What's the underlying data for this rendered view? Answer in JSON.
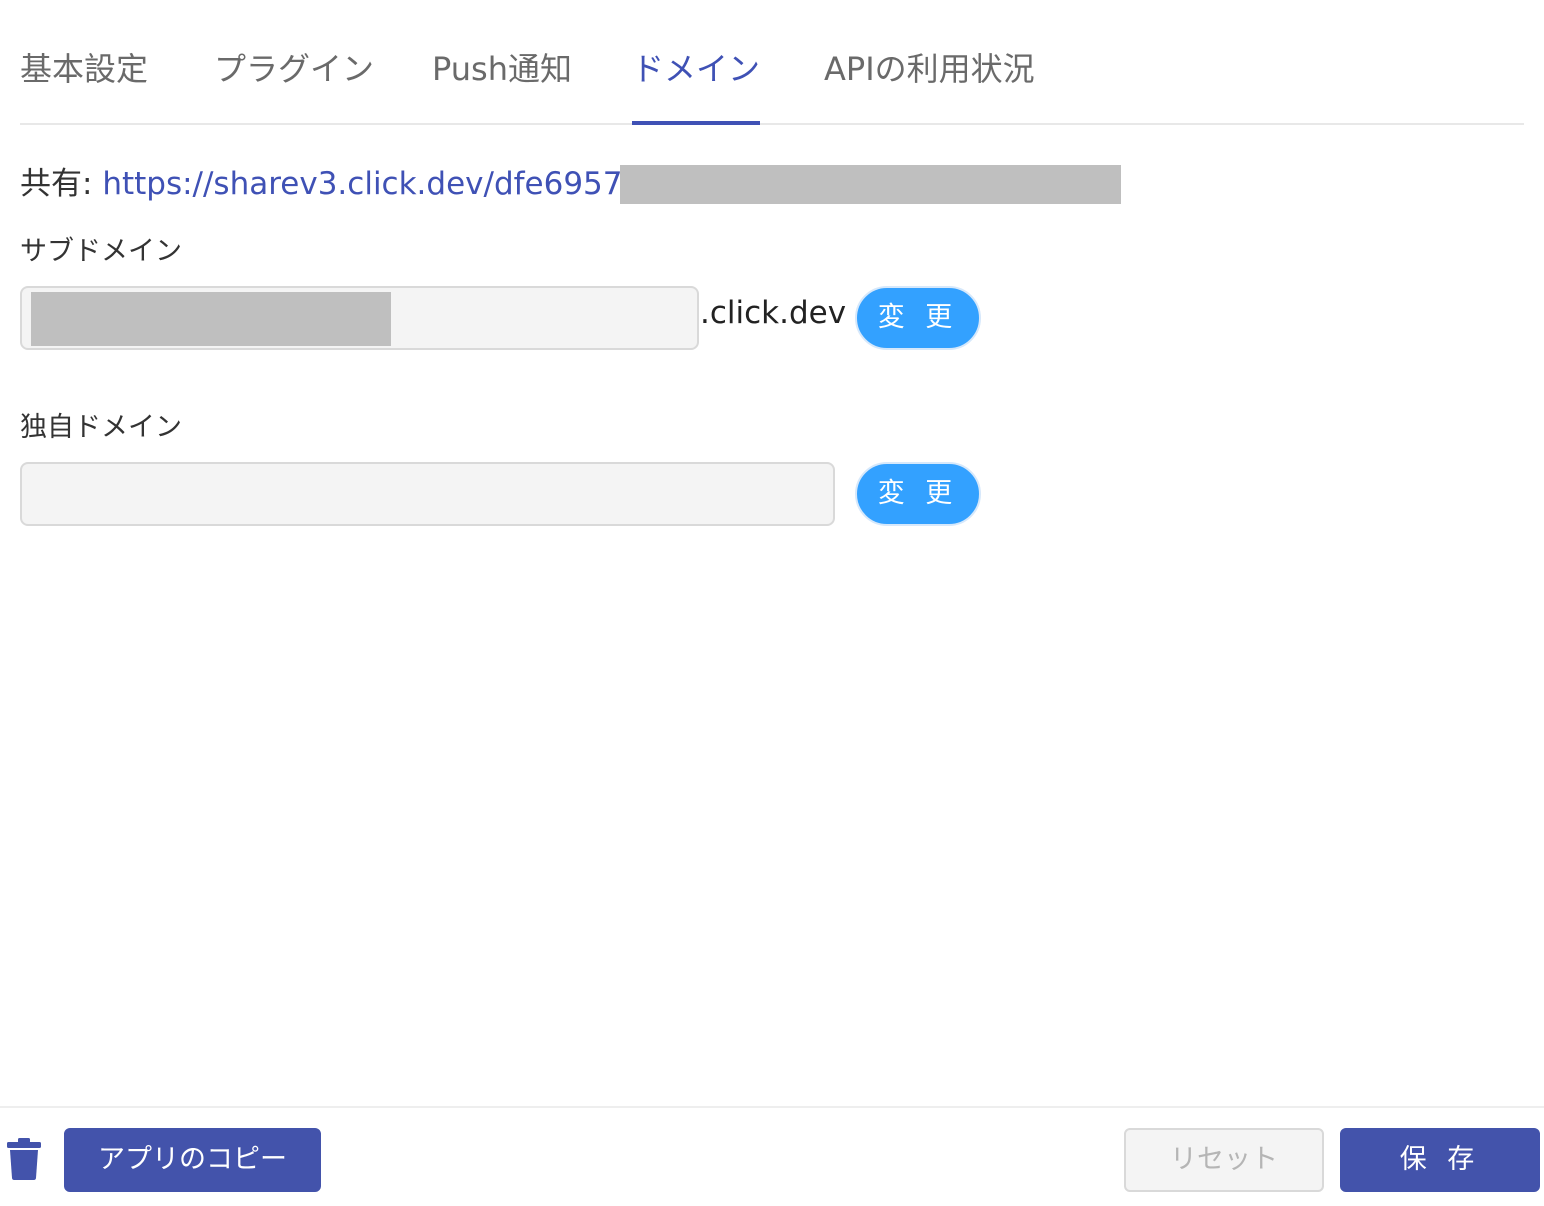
{
  "tabs": [
    {
      "label": "基本設定",
      "active": false
    },
    {
      "label": "プラグイン",
      "active": false
    },
    {
      "label": "Push通知",
      "active": false
    },
    {
      "label": "ドメイン",
      "active": true
    },
    {
      "label": "APIの利用状況",
      "active": false
    }
  ],
  "share": {
    "label": "共有:",
    "url": "https://sharev3.click.dev/dfe69570-"
  },
  "subdomain": {
    "label": "サブドメイン",
    "value": "",
    "suffix": ".click.dev",
    "button": "変 更"
  },
  "custom_domain": {
    "label": "独自ドメイン",
    "value": "",
    "button": "変 更"
  },
  "footer": {
    "delete_icon": "trash-icon",
    "copy_app": "アプリのコピー",
    "reset": "リセット",
    "save": "保 存"
  },
  "colors": {
    "accent": "#3f51b5",
    "pill_blue": "#33a1ff",
    "primary_button": "#4353ab"
  }
}
